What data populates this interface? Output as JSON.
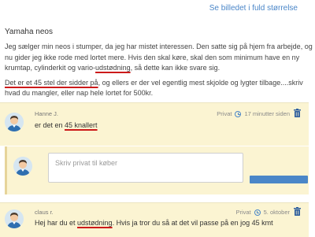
{
  "header": {
    "full_size_link": "Se billedet i fuld størrelse"
  },
  "post": {
    "title": "Yamaha neos",
    "paragraph1": {
      "before": "Jeg sælger min neos i stumper, da jeg har mistet interessen. Den satte sig på hjem fra arbejde, og nu gider jeg ikke rode med lortet mere. Hvis den skal køre, skal den som minimum have en ny krumtap, cylinderkit og vario-",
      "highlight": "udstødning",
      "after": ", så dette kan ikke svare sig."
    },
    "paragraph2": {
      "highlight": "Det er et 45 stel der sidder på",
      "after": ", og ellers er der vel egentlig mest skjolde og lygter tilbage....skriv hvad du mangler, eller nap hele lortet for 500kr."
    }
  },
  "comments": [
    {
      "author": "Hanne J.",
      "visibility": "Privat",
      "time": "17 minutter siden",
      "text_before": "er det en ",
      "text_highlight": "45 knallert",
      "text_after": ""
    },
    {
      "author": "claus r.",
      "visibility": "Privat",
      "time": "5. oktober",
      "text_before": "Hej har du et ",
      "text_highlight": "udstødning",
      "text_after": ". Hvis ja tror du så at det vil passe på en jog 45 kmt"
    }
  ],
  "reply": {
    "placeholder": "Skriv privat til køber"
  },
  "icons": {
    "avatar": "person-avatar-icon",
    "clock": "clock-icon",
    "trash": "trash-icon"
  },
  "colors": {
    "accent": "#4a86c8",
    "comment_bg": "#fbf4d2",
    "highlight_underline": "#cc1a1a"
  }
}
